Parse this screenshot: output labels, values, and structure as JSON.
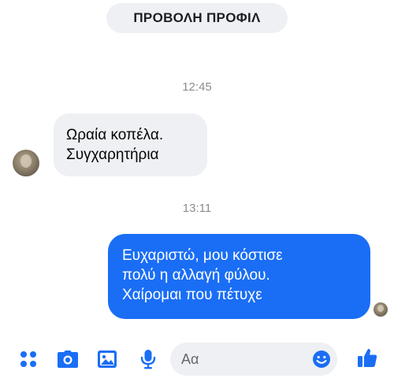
{
  "header": {
    "profile_button_label": "ΠΡΟΒΟΛΗ ΠΡΟΦΙΛ"
  },
  "messages": [
    {
      "time": "12:45",
      "direction": "incoming",
      "lines": [
        "Ωραία κοπέλα.",
        "Συγχαρητήρια"
      ]
    },
    {
      "time": "13:11",
      "direction": "outgoing",
      "lines": [
        "Ευχαριστώ, μου κόστισε",
        "πολύ η αλλαγή φύλου.",
        "Χαίρομαι που πέτυχε"
      ]
    }
  ],
  "composer": {
    "placeholder": "Αα",
    "icons": [
      "menu-dots-icon",
      "camera-icon",
      "image-icon",
      "microphone-icon",
      "emoji-icon",
      "thumbs-up-icon"
    ]
  },
  "colors": {
    "accent": "#1a6ef5",
    "incoming_bubble": "#eef0f3",
    "timestamp": "#8a8d91"
  }
}
